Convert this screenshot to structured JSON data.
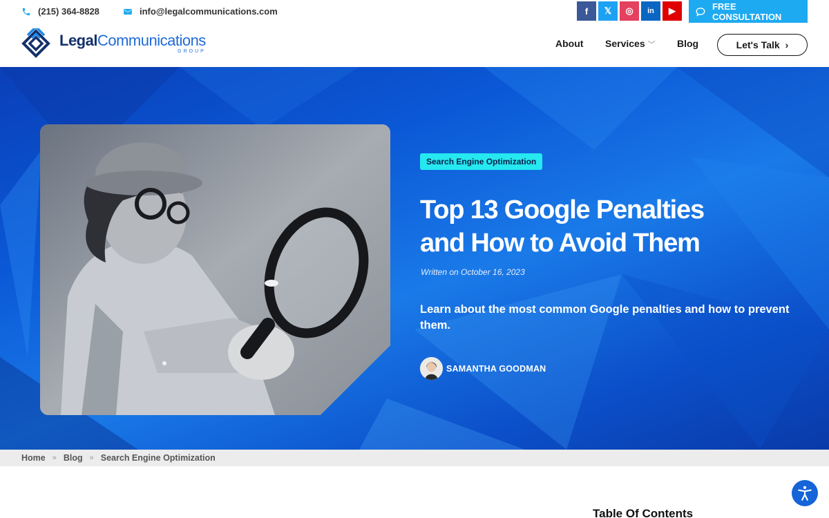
{
  "topbar": {
    "phone": "(215) 364-8828",
    "email": "info@legalcommunications.com",
    "socials": [
      {
        "name": "facebook",
        "glyph": "f",
        "color": "#3b5998"
      },
      {
        "name": "x",
        "glyph": "𝕏",
        "color": "#1da1f2"
      },
      {
        "name": "instagram",
        "glyph": "◎",
        "color": "#e4405f"
      },
      {
        "name": "linkedin",
        "glyph": "in",
        "color": "#0a66c2"
      },
      {
        "name": "youtube",
        "glyph": "▶",
        "color": "#e00000"
      }
    ],
    "consult_label": "FREE CONSULTATION",
    "consult_color": "#1eaaf1"
  },
  "header": {
    "logo_bold": "Legal",
    "logo_light": "Communications",
    "logo_sub": "GROUP",
    "nav": {
      "about": "About",
      "services": "Services",
      "blog": "Blog"
    },
    "cta": "Let's Talk"
  },
  "hero": {
    "category": "Search Engine Optimization",
    "title": "Top 13 Google Penalties and How to Avoid Them",
    "date": "Written on October 16, 2023",
    "subtitle": "Learn about the most common Google penalties and how to prevent them.",
    "author": "SAMANTHA GOODMAN",
    "accent": "#26e8f0",
    "background": "#0b58d6"
  },
  "breadcrumb": [
    "Home",
    "Blog",
    "Search Engine Optimization"
  ],
  "sidebar": {
    "toc_title": "Table Of Contents"
  }
}
